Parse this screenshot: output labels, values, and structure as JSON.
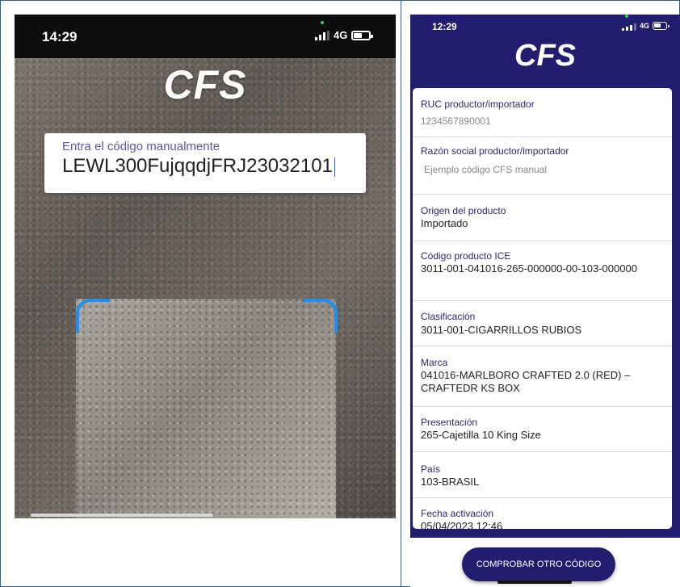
{
  "left_screen": {
    "status_time": "14:29",
    "network": "4G",
    "logo": "CFS",
    "manual_entry": {
      "label": "Entra el código manualmente",
      "value": "LEWL300FujqqdjFRJ23032101"
    }
  },
  "right_screen": {
    "status_time": "12:29",
    "network": "4G",
    "logo": "CFS",
    "fields": [
      {
        "label": "RUC productor/importador",
        "value": "1234567890001"
      },
      {
        "label": "Razón social productor/importador",
        "value": "Ejemplo código CFS manual"
      },
      {
        "label": "Origen del producto",
        "value": "Importado"
      },
      {
        "label": "Código producto ICE",
        "value": "3011-001-041016-265-000000-00-103-000000"
      },
      {
        "label": "Clasificación",
        "value": "3011-001-CIGARRILLOS RUBIOS"
      },
      {
        "label": "Marca",
        "value": "041016-MARLBORO CRAFTED 2.0 (RED) – CRAFTEDR KS BOX"
      },
      {
        "label": "Presentación",
        "value": "265-Cajetilla 10 King Size"
      },
      {
        "label": "País",
        "value": "103-BRASIL"
      },
      {
        "label": "Fecha activación",
        "value": "05/04/2023 12:46"
      }
    ],
    "button_label": "COMPROBAR OTRO CÓDIGO"
  }
}
